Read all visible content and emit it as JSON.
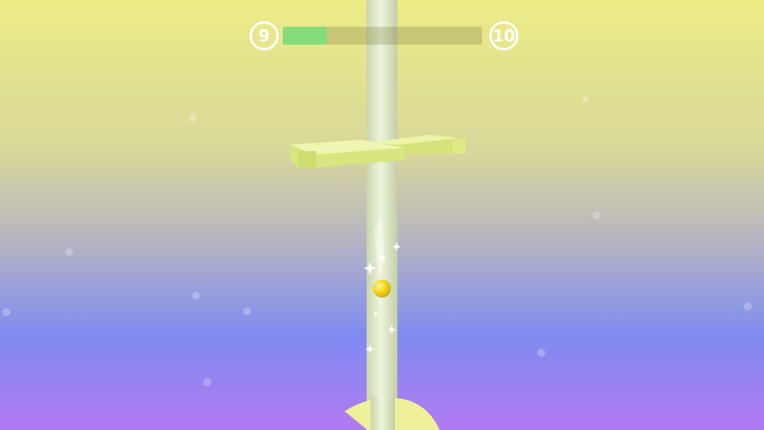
{
  "hud": {
    "current_level": "9",
    "next_level": "10",
    "progress_fraction": 0.22
  },
  "colors": {
    "sky_top": "#ecec86",
    "sky_middle": "#b8b6c0",
    "sky_lower": "#7f8cf0",
    "sky_bottom": "#b27af2",
    "tower": "#e0ecc8",
    "platform": "#e2f08e",
    "ball": "#f4d81c",
    "progress_fill": "#86dc7a"
  },
  "icons": {
    "ball": "ball-icon",
    "sparkles": "sparkle-icon"
  }
}
